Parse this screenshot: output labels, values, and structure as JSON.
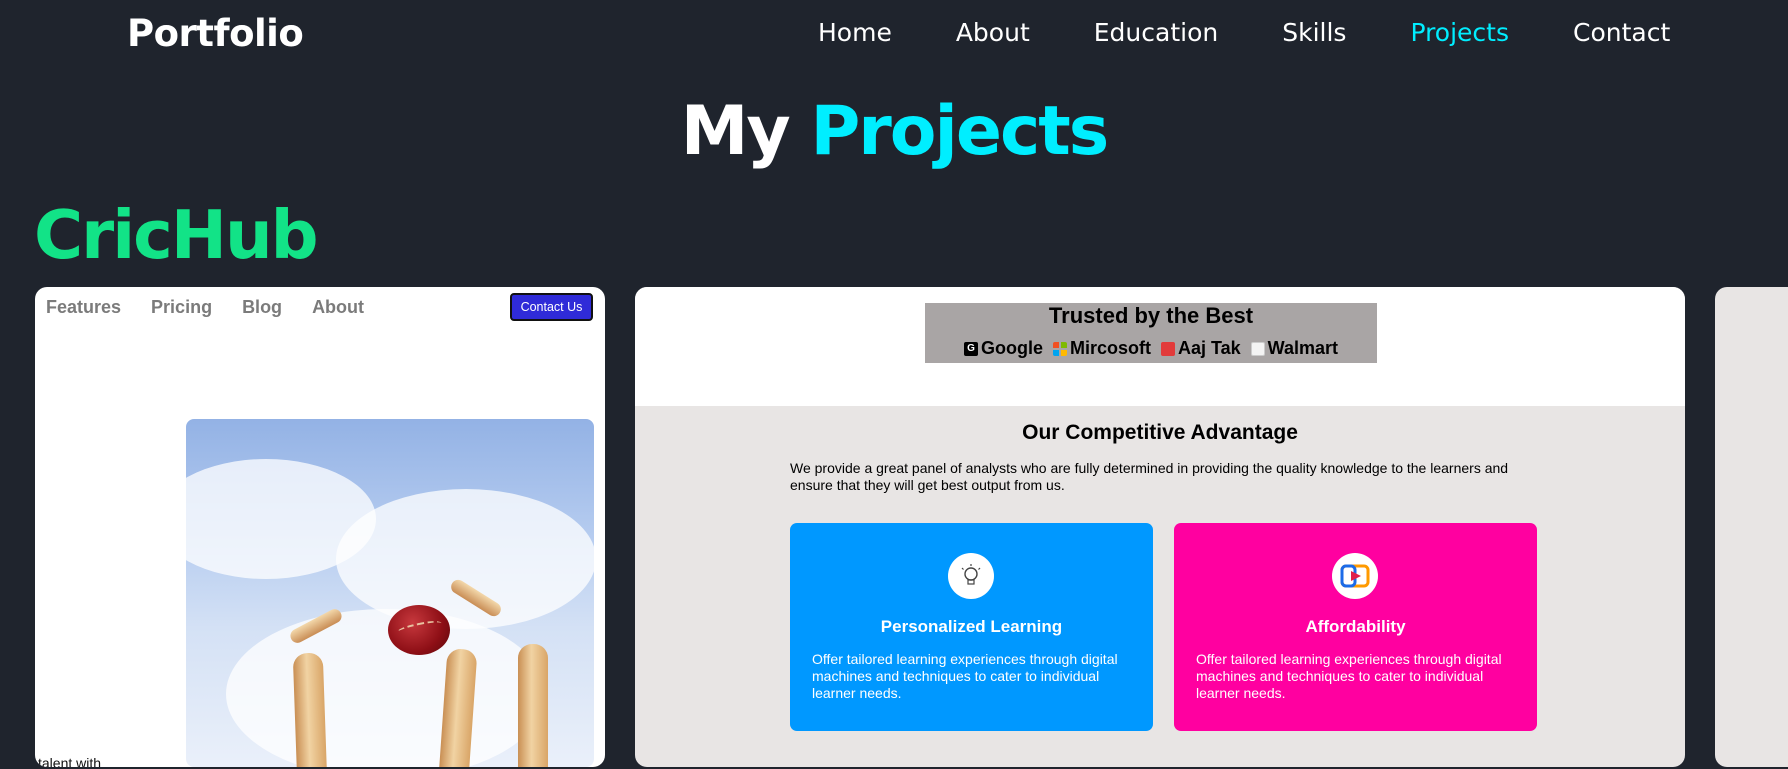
{
  "navbar": {
    "logo": "Portfolio",
    "links": [
      "Home",
      "About",
      "Education",
      "Skills",
      "Projects",
      "Contact"
    ],
    "active": "Projects"
  },
  "heading": {
    "part1": "My",
    "part2": "Projects"
  },
  "project": {
    "title": "CricHub",
    "preview": {
      "nav": [
        "Features",
        "Pricing",
        "Blog",
        "About"
      ],
      "contact_button": "Contact Us",
      "snippet_text": "talent with"
    },
    "trusted": {
      "title": "Trusted by the Best",
      "brands": [
        {
          "name": "Google",
          "icon": "google-icon"
        },
        {
          "name": "Mircosoft",
          "icon": "microsoft-icon"
        },
        {
          "name": "Aaj Tak",
          "icon": "aaj-tak-icon"
        },
        {
          "name": "Walmart",
          "icon": "walmart-icon"
        }
      ]
    },
    "advantage": {
      "title": "Our Competitive Advantage",
      "description": "We provide a great panel of analysts who are fully determined in providing the quality knowledge to the learners and ensure that they will get best output from us.",
      "features": [
        {
          "title": "Personalized Learning",
          "description": "Offer tailored learning experiences through digital machines and techniques to cater to individual learner needs.",
          "color": "#0098ff",
          "icon": "lightbulb-icon"
        },
        {
          "title": "Affordability",
          "description": "Offer tailored learning experiences through digital machines and techniques to cater to individual learner needs.",
          "color": "#ff00a0",
          "icon": "video-play-icon"
        }
      ]
    }
  },
  "colors": {
    "background": "#1f242d",
    "accent": "#00eeff",
    "project_title": "#12e387"
  }
}
